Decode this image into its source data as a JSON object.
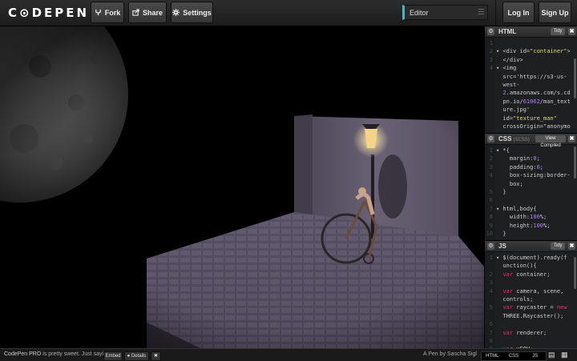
{
  "header": {
    "logo": "C⊙DEPEN",
    "fork_label": "Fork",
    "share_label": "Share",
    "settings_label": "Settings",
    "editor_label": "Editor",
    "login_label": "Log In",
    "signup_label": "Sign Up"
  },
  "panels": {
    "html": {
      "title": "HTML",
      "tidy": "Tidy",
      "lines": [
        {
          "n": "1",
          "text": ""
        },
        {
          "n": "2",
          "text": "▾ <div id=\"container\">"
        },
        {
          "n": "3",
          "text": "  </div>"
        },
        {
          "n": "4",
          "text": "▾ <img"
        },
        {
          "n": "",
          "text": "  src='https://s3-us-"
        },
        {
          "n": "",
          "text": "  west-"
        },
        {
          "n": "",
          "text": "  2.amazonaws.com/s.cd"
        },
        {
          "n": "",
          "text": "  pn.io/61062/man_text"
        },
        {
          "n": "",
          "text": "  ure.jpg'"
        },
        {
          "n": "",
          "text": "  id=\"texture_man\""
        },
        {
          "n": "",
          "text": "  crossOrigin=\"anonymo"
        }
      ]
    },
    "css": {
      "title": "CSS",
      "subtitle": "(SCSS)",
      "compiled": "View Compiled",
      "lines": [
        {
          "n": "1",
          "text": "▾ *{"
        },
        {
          "n": "2",
          "text": "    margin:0;"
        },
        {
          "n": "3",
          "text": "    padding:0;"
        },
        {
          "n": "4",
          "text": "    box-sizing:border-"
        },
        {
          "n": "",
          "text": "    box;"
        },
        {
          "n": "5",
          "text": "  }"
        },
        {
          "n": "6",
          "text": ""
        },
        {
          "n": "7",
          "text": "▾ html,body{"
        },
        {
          "n": "8",
          "text": "    width:100%;"
        },
        {
          "n": "9",
          "text": "    height:100%;"
        },
        {
          "n": "10",
          "text": "  }"
        }
      ]
    },
    "js": {
      "title": "JS",
      "tidy": "Tidy",
      "lines": [
        {
          "n": "1",
          "text": "▾ $(document).ready(f"
        },
        {
          "n": "",
          "text": "  unction(){"
        },
        {
          "n": "2",
          "text": "  var container;"
        },
        {
          "n": "3",
          "text": ""
        },
        {
          "n": "4",
          "text": "  var camera, scene,"
        },
        {
          "n": "",
          "text": "  controls;"
        },
        {
          "n": "5",
          "text": "  var raycaster = new"
        },
        {
          "n": "",
          "text": "  THREE.Raycaster();"
        },
        {
          "n": "6",
          "text": ""
        },
        {
          "n": "7",
          "text": "  var renderer;"
        },
        {
          "n": "8",
          "text": ""
        },
        {
          "n": "9",
          "text": "  var vFOV;"
        }
      ]
    }
  },
  "footer": {
    "promo_prefix": "CodePen PRO",
    "promo_suffix": " is pretty sweet. Just saying.",
    "embed": "Embed",
    "details": "Details",
    "close": "✖",
    "credit": "A Pen by Sascha Sigl",
    "tab_html": "HTML",
    "tab_css": "CSS",
    "tab_js": "JS"
  },
  "colors": {
    "accent": "#4fb3c7",
    "topbar": "#222222",
    "panel_bg": "#1d1f20"
  }
}
